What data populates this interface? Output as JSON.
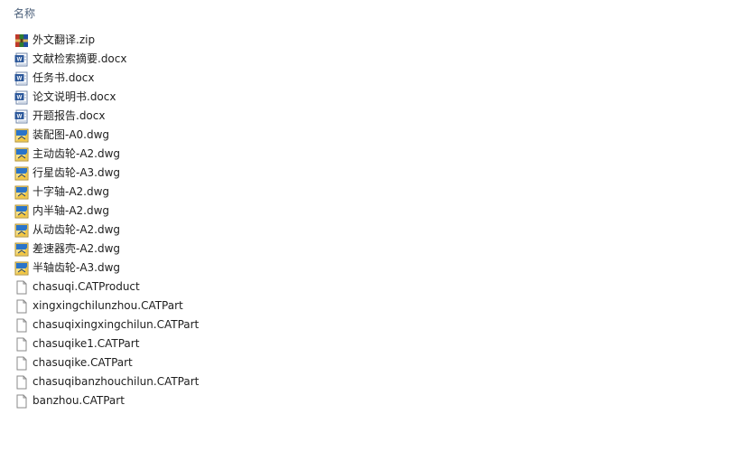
{
  "header": {
    "column_name": "名称"
  },
  "files": [
    {
      "name": "外文翻译.zip",
      "type": "zip-archive-icon"
    },
    {
      "name": "文献检索摘要.docx",
      "type": "word-document-icon"
    },
    {
      "name": "任务书.docx",
      "type": "word-document-icon"
    },
    {
      "name": "论文说明书.docx",
      "type": "word-document-icon"
    },
    {
      "name": "开题报告.docx",
      "type": "word-document-icon"
    },
    {
      "name": "装配图-A0.dwg",
      "type": "dwg-file-icon"
    },
    {
      "name": "主动齿轮-A2.dwg",
      "type": "dwg-file-icon"
    },
    {
      "name": "行星齿轮-A3.dwg",
      "type": "dwg-file-icon"
    },
    {
      "name": "十字轴-A2.dwg",
      "type": "dwg-file-icon"
    },
    {
      "name": "内半轴-A2.dwg",
      "type": "dwg-file-icon"
    },
    {
      "name": "从动齿轮-A2.dwg",
      "type": "dwg-file-icon"
    },
    {
      "name": "差速器壳-A2.dwg",
      "type": "dwg-file-icon"
    },
    {
      "name": "半轴齿轮-A3.dwg",
      "type": "dwg-file-icon"
    },
    {
      "name": "chasuqi.CATProduct",
      "type": "blank-file-icon"
    },
    {
      "name": "xingxingchilunzhou.CATPart",
      "type": "blank-file-icon"
    },
    {
      "name": "chasuqixingxingchilun.CATPart",
      "type": "blank-file-icon"
    },
    {
      "name": "chasuqike1.CATPart",
      "type": "blank-file-icon"
    },
    {
      "name": "chasuqike.CATPart",
      "type": "blank-file-icon"
    },
    {
      "name": "chasuqibanzhouchilun.CATPart",
      "type": "blank-file-icon"
    },
    {
      "name": "banzhou.CATPart",
      "type": "blank-file-icon"
    }
  ],
  "colors": {
    "header_text": "#4c607a",
    "word_blue": "#2b579a",
    "zip_red": "#c0392b",
    "dwg_yellow": "#f2c744"
  }
}
